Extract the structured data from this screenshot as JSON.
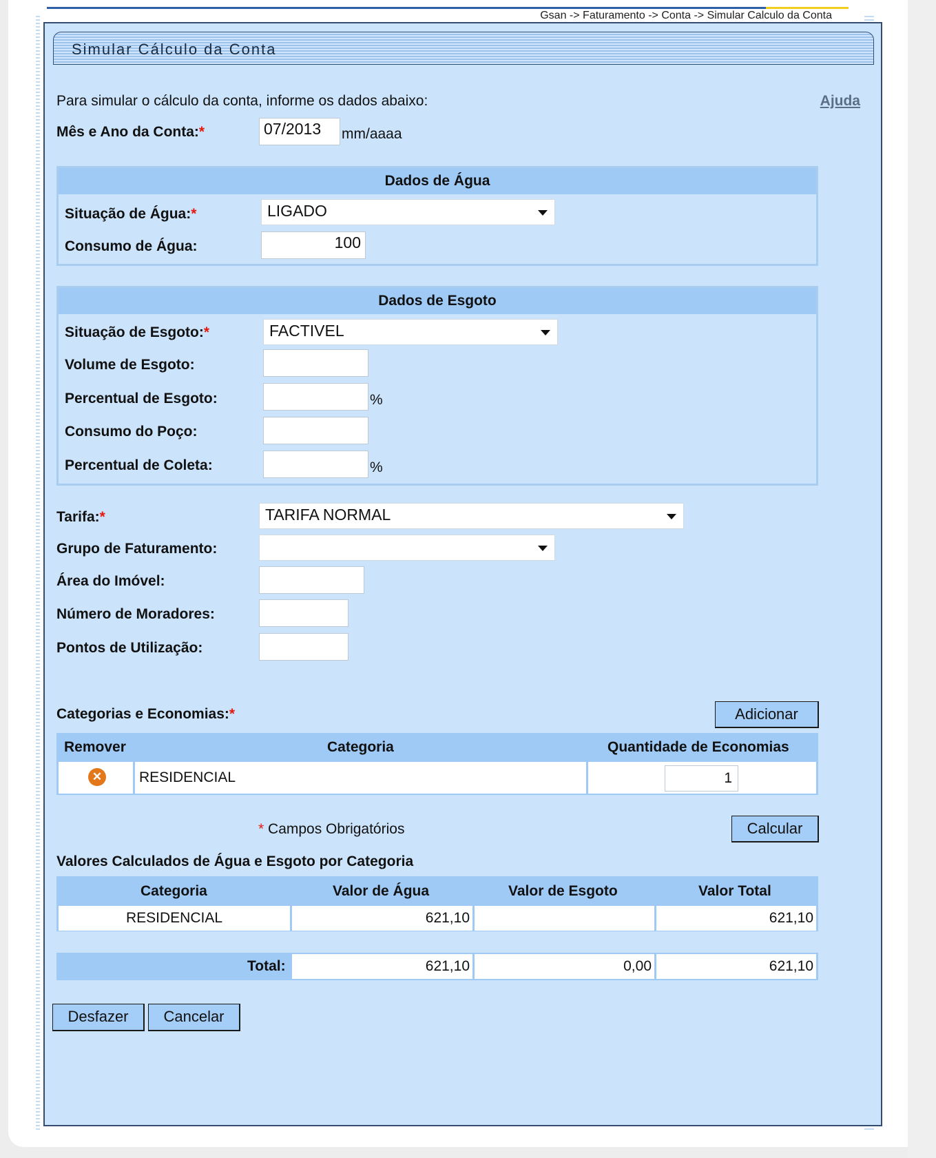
{
  "breadcrumb": "Gsan -> Faturamento -> Conta -> Simular Calculo da Conta",
  "title": "Simular Cálculo da Conta",
  "intro": "Para simular o cálculo da conta, informe os dados abaixo:",
  "help_link": "Ajuda",
  "mes_ano": {
    "label": "Mês e Ano da Conta:",
    "required": "*",
    "value": "07/2013",
    "hint": "mm/aaaa"
  },
  "agua": {
    "header": "Dados de Água",
    "situacao": {
      "label": "Situação de Água:",
      "required": "*",
      "value": "LIGADO"
    },
    "consumo": {
      "label": "Consumo de Água:",
      "value": "100"
    }
  },
  "esgoto": {
    "header": "Dados de Esgoto",
    "situacao": {
      "label": "Situação de Esgoto:",
      "required": "*",
      "value": "FACTIVEL"
    },
    "volume": {
      "label": "Volume de Esgoto:",
      "value": ""
    },
    "percentual": {
      "label": "Percentual de Esgoto:",
      "value": "",
      "unit": "%"
    },
    "consumo_poco": {
      "label": "Consumo do Poço:",
      "value": ""
    },
    "percentual_coleta": {
      "label": "Percentual de Coleta:",
      "value": "",
      "unit": "%"
    }
  },
  "tarifa": {
    "label": "Tarifa:",
    "required": "*",
    "value": "TARIFA NORMAL"
  },
  "grupo": {
    "label": "Grupo de Faturamento:",
    "value": ""
  },
  "area": {
    "label": "Área do Imóvel:",
    "value": ""
  },
  "moradores": {
    "label": "Número de Moradores:",
    "value": ""
  },
  "pontos": {
    "label": "Pontos de Utilização:",
    "value": ""
  },
  "categorias": {
    "label": "Categorias e Economias:",
    "required": "*",
    "add_button": "Adicionar",
    "headers": {
      "remover": "Remover",
      "categoria": "Categoria",
      "quantidade": "Quantidade de Economias"
    },
    "rows": [
      {
        "remove_icon": "remove-circle-icon",
        "categoria": "RESIDENCIAL",
        "quantidade": "1"
      }
    ]
  },
  "required_note": {
    "mark": "*",
    "text": "Campos Obrigatórios"
  },
  "calcular_button": "Calcular",
  "valores": {
    "title": "Valores Calculados de Água e Esgoto por Categoria",
    "headers": {
      "categoria": "Categoria",
      "agua": "Valor de Água",
      "esgoto": "Valor de Esgoto",
      "total": "Valor Total"
    },
    "rows": [
      {
        "categoria": "RESIDENCIAL",
        "agua": "621,10",
        "esgoto": "",
        "total": "621,10"
      }
    ],
    "totals": {
      "label": "Total:",
      "agua": "621,10",
      "esgoto": "0,00",
      "total": "621,10"
    }
  },
  "buttons": {
    "desfazer": "Desfazer",
    "cancelar": "Cancelar"
  },
  "colors": {
    "panel_bg": "#cce4fb",
    "header_bg": "#9fcaf6",
    "button_bg": "#a4cdf7",
    "required": "#e5190f",
    "remove_icon": "#e3781a"
  }
}
